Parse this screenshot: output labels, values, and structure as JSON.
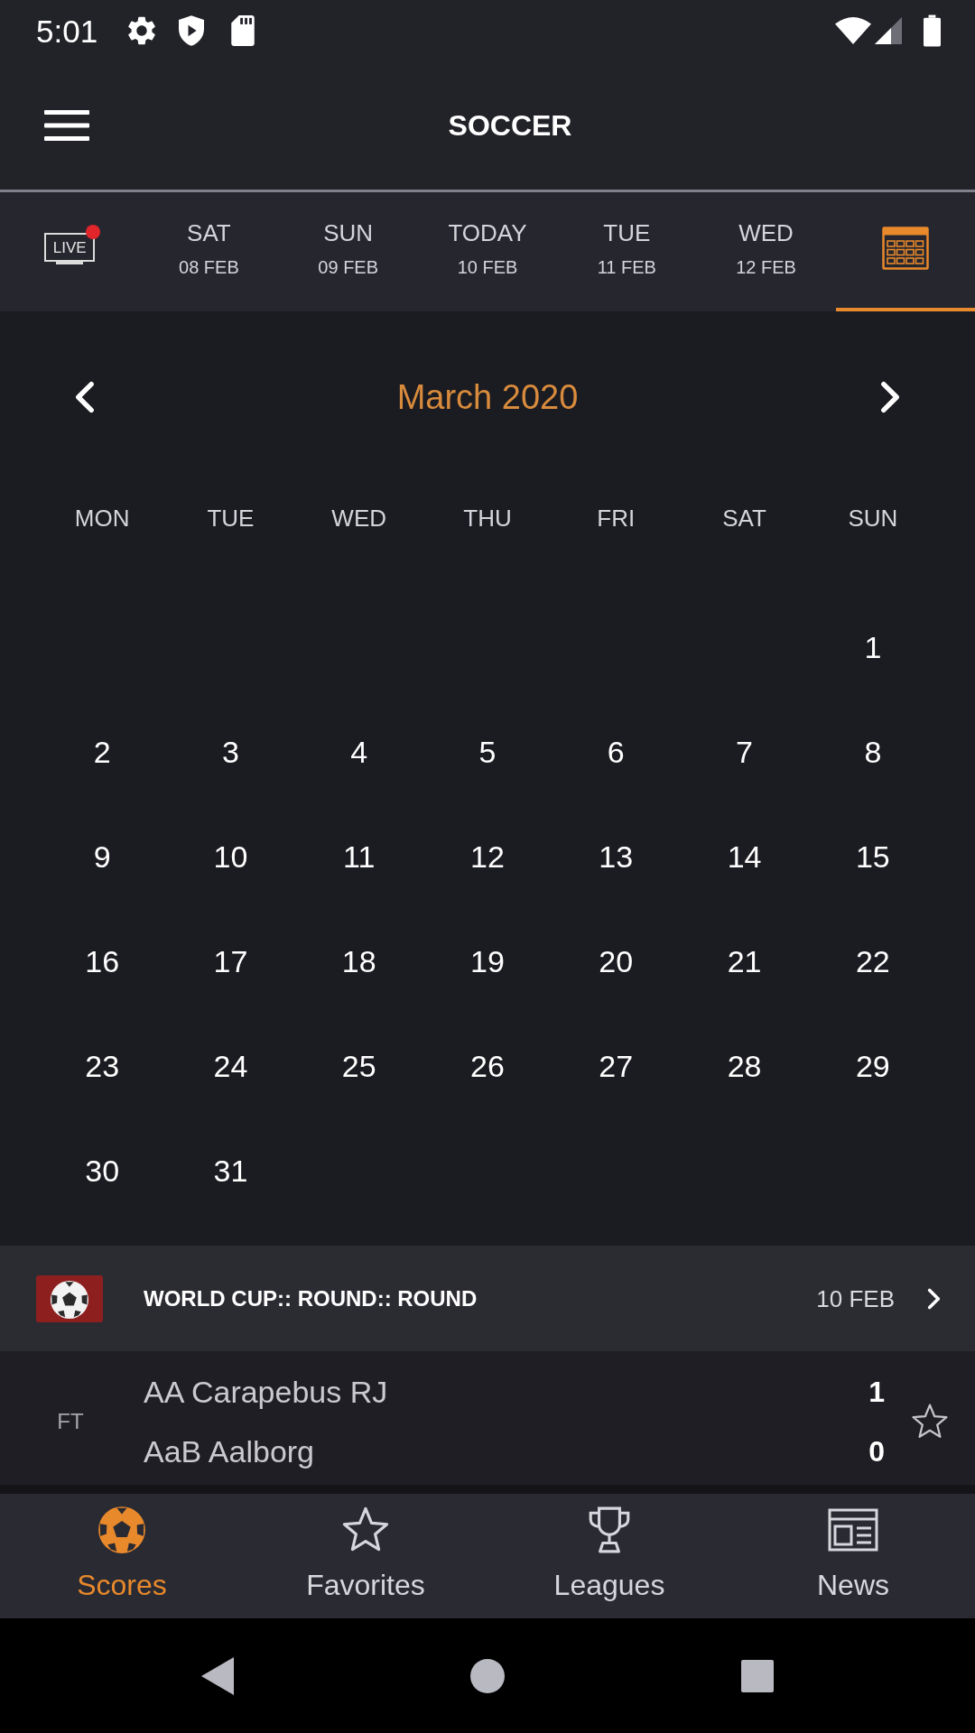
{
  "status_bar": {
    "time": "5:01"
  },
  "app_bar": {
    "title": "SOCCER"
  },
  "date_tabs": [
    {
      "kind": "live",
      "label": "LIVE",
      "alert": true,
      "selected": false
    },
    {
      "kind": "day",
      "day": "SAT",
      "date": "08 FEB",
      "selected": false
    },
    {
      "kind": "day",
      "day": "SUN",
      "date": "09 FEB",
      "selected": false
    },
    {
      "kind": "day",
      "day": "TODAY",
      "date": "10 FEB",
      "selected": false
    },
    {
      "kind": "day",
      "day": "TUE",
      "date": "11 FEB",
      "selected": false
    },
    {
      "kind": "day",
      "day": "WED",
      "date": "12 FEB",
      "selected": false
    },
    {
      "kind": "calendar",
      "selected": true
    }
  ],
  "calendar": {
    "month": "March 2020",
    "weekdays": [
      "MON",
      "TUE",
      "WED",
      "THU",
      "FRI",
      "SAT",
      "SUN"
    ],
    "weeks": [
      {
        "kind": "end",
        "days": [
          "1"
        ]
      },
      {
        "kind": "full",
        "days": [
          "2",
          "3",
          "4",
          "5",
          "6",
          "7",
          "8"
        ]
      },
      {
        "kind": "full",
        "days": [
          "9",
          "10",
          "11",
          "12",
          "13",
          "14",
          "15"
        ]
      },
      {
        "kind": "full",
        "days": [
          "16",
          "17",
          "18",
          "19",
          "20",
          "21",
          "22"
        ]
      },
      {
        "kind": "full",
        "days": [
          "23",
          "24",
          "25",
          "26",
          "27",
          "28",
          "29"
        ]
      },
      {
        "kind": "start",
        "days": [
          "30",
          "31"
        ]
      }
    ]
  },
  "league": {
    "title": "WORLD CUP:: ROUND:: ROUND",
    "date": "10 FEB"
  },
  "match": {
    "status": "FT",
    "teams": [
      {
        "name": "AA Carapebus RJ",
        "score": "1"
      },
      {
        "name": "AaB Aalborg",
        "score": "0"
      }
    ],
    "favorite": false
  },
  "bottom_nav": [
    {
      "label": "Scores",
      "selected": true
    },
    {
      "label": "Favorites",
      "selected": false
    },
    {
      "label": "Leagues",
      "selected": false
    },
    {
      "label": "News",
      "selected": false
    }
  ]
}
